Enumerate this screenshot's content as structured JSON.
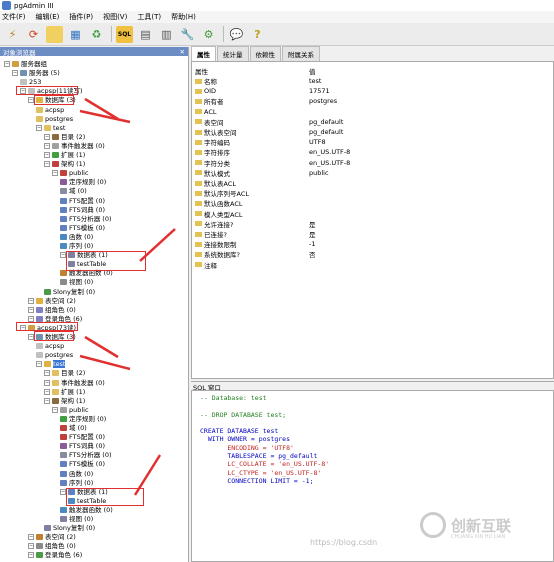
{
  "window": {
    "title": "pgAdmin III"
  },
  "menu": [
    "文件(F)",
    "编辑(E)",
    "插件(P)",
    "视图(V)",
    "工具(T)",
    "帮助(H)"
  ],
  "left_pane": {
    "title": "对象浏览器",
    "tree": [
      {
        "label": "服务器组",
        "indent": 0
      },
      {
        "label": "服务器 (5)",
        "indent": 1
      },
      {
        "label": "253",
        "indent": 2
      },
      {
        "label": "acpsp(11读写)",
        "indent": 2
      },
      {
        "label": "数据库 (3)",
        "indent": 3
      },
      {
        "label": "acpsp",
        "indent": 4
      },
      {
        "label": "postgres",
        "indent": 4
      },
      {
        "label": "test",
        "indent": 4
      },
      {
        "label": "目录 (2)",
        "indent": 5
      },
      {
        "label": "事件触发器 (0)",
        "indent": 5
      },
      {
        "label": "扩展 (1)",
        "indent": 5
      },
      {
        "label": "架构 (1)",
        "indent": 5
      },
      {
        "label": "public",
        "indent": 6
      },
      {
        "label": "定序规则 (0)",
        "indent": 7
      },
      {
        "label": "域 (0)",
        "indent": 7
      },
      {
        "label": "FTS配置 (0)",
        "indent": 7
      },
      {
        "label": "FTS词典 (0)",
        "indent": 7
      },
      {
        "label": "FTS分析器 (0)",
        "indent": 7
      },
      {
        "label": "FTS模板 (0)",
        "indent": 7
      },
      {
        "label": "函数 (0)",
        "indent": 7
      },
      {
        "label": "序列 (0)",
        "indent": 7
      },
      {
        "label": "数据表 (1)",
        "indent": 7
      },
      {
        "label": "testTable",
        "indent": 8
      },
      {
        "label": "触发器函数 (0)",
        "indent": 7
      },
      {
        "label": "视图 (0)",
        "indent": 7
      },
      {
        "label": "Slony复制 (0)",
        "indent": 5
      },
      {
        "label": "表空间 (2)",
        "indent": 3
      },
      {
        "label": "组角色 (0)",
        "indent": 3
      },
      {
        "label": "登录角色 (6)",
        "indent": 3
      },
      {
        "label": "acpsp(73读)",
        "indent": 2
      },
      {
        "label": "数据库 (3)",
        "indent": 3
      },
      {
        "label": "acpsp",
        "indent": 4
      },
      {
        "label": "postgres",
        "indent": 4
      },
      {
        "label": "test",
        "indent": 4
      },
      {
        "label": "目录 (2)",
        "indent": 5
      },
      {
        "label": "事件触发器 (0)",
        "indent": 5
      },
      {
        "label": "扩展 (1)",
        "indent": 5
      },
      {
        "label": "架构 (1)",
        "indent": 5
      },
      {
        "label": "public",
        "indent": 6
      },
      {
        "label": "定序规则 (0)",
        "indent": 7
      },
      {
        "label": "域 (0)",
        "indent": 7
      },
      {
        "label": "FTS配置 (0)",
        "indent": 7
      },
      {
        "label": "FTS词典 (0)",
        "indent": 7
      },
      {
        "label": "FTS分析器 (0)",
        "indent": 7
      },
      {
        "label": "FTS模板 (0)",
        "indent": 7
      },
      {
        "label": "函数 (0)",
        "indent": 7
      },
      {
        "label": "序列 (0)",
        "indent": 7
      },
      {
        "label": "数据表 (1)",
        "indent": 7
      },
      {
        "label": "testTable",
        "indent": 8
      },
      {
        "label": "触发器函数 (0)",
        "indent": 7
      },
      {
        "label": "视图 (0)",
        "indent": 7
      },
      {
        "label": "Slony复制 (0)",
        "indent": 5
      },
      {
        "label": "表空间 (2)",
        "indent": 3
      },
      {
        "label": "组角色 (0)",
        "indent": 3
      },
      {
        "label": "登录角色 (6)",
        "indent": 3
      }
    ]
  },
  "right_pane": {
    "tabs": [
      "属性",
      "统计量",
      "依赖性",
      "附属关系"
    ],
    "columns": {
      "name": "属性",
      "value": "值"
    },
    "properties": [
      {
        "name": "名称",
        "value": "test"
      },
      {
        "name": "OID",
        "value": "17571"
      },
      {
        "name": "所有者",
        "value": "postgres"
      },
      {
        "name": "ACL",
        "value": ""
      },
      {
        "name": "表空间",
        "value": "pg_default"
      },
      {
        "name": "默认表空间",
        "value": "pg_default"
      },
      {
        "name": "字符编码",
        "value": "UTF8"
      },
      {
        "name": "字符排序",
        "value": "en_US.UTF-8"
      },
      {
        "name": "字符分类",
        "value": "en_US.UTF-8"
      },
      {
        "name": "默认模式",
        "value": "public"
      },
      {
        "name": "默认表ACL",
        "value": ""
      },
      {
        "name": "默认序列号ACL",
        "value": ""
      },
      {
        "name": "默认函数ACL",
        "value": ""
      },
      {
        "name": "模人类型ACL",
        "value": ""
      },
      {
        "name": "允许连接?",
        "value": "是"
      },
      {
        "name": "已连接?",
        "value": "是"
      },
      {
        "name": "连接数限制",
        "value": "-1"
      },
      {
        "name": "系统数据库?",
        "value": "否"
      },
      {
        "name": "注释",
        "value": ""
      }
    ],
    "sql_title": "SQL 窗口",
    "sql_lines": [
      "-- Database: test",
      "",
      "-- DROP DATABASE test;",
      "",
      "CREATE DATABASE test",
      "  WITH OWNER = postgres",
      "       ENCODING = 'UTF8'",
      "       TABLESPACE = pg_default",
      "       LC_COLLATE = 'en_US.UTF-8'",
      "       LC_CTYPE = 'en_US.UTF-8'",
      "       CONNECTION LIMIT = -1;"
    ]
  },
  "watermark": {
    "brand": "创新互联",
    "sub": "CHUANG XIN HU LIAN",
    "blog": "https://blog.csdn"
  }
}
